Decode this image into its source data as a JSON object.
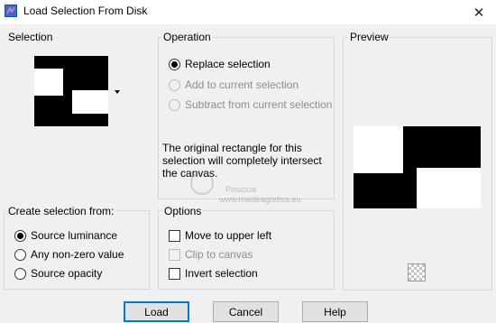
{
  "window": {
    "title": "Load Selection From Disk"
  },
  "selection": {
    "label": "Selection"
  },
  "operation": {
    "label": "Operation",
    "options": [
      {
        "label": "Replace selection",
        "checked": true,
        "disabled": false
      },
      {
        "label": "Add to current selection",
        "checked": false,
        "disabled": true
      },
      {
        "label": "Subtract from current selection",
        "checked": false,
        "disabled": true
      }
    ],
    "description_lines": [
      "The original rectangle for this",
      "selection will completely intersect",
      "the canvas."
    ]
  },
  "preview": {
    "label": "Preview"
  },
  "create_from": {
    "label": "Create selection from:",
    "options": [
      {
        "label": "Source luminance",
        "checked": true
      },
      {
        "label": "Any non-zero value",
        "checked": false
      },
      {
        "label": "Source opacity",
        "checked": false
      }
    ]
  },
  "options": {
    "label": "Options",
    "items": [
      {
        "label": "Move to upper left",
        "checked": false,
        "disabled": false
      },
      {
        "label": "Clip to canvas",
        "checked": false,
        "disabled": true
      },
      {
        "label": "Invert selection",
        "checked": false,
        "disabled": false
      }
    ]
  },
  "buttons": {
    "load": "Load",
    "cancel": "Cancel",
    "help": "Help"
  },
  "watermark": {
    "line1": "Pinuccia",
    "line2": "www.maldiragrafica.eu"
  }
}
